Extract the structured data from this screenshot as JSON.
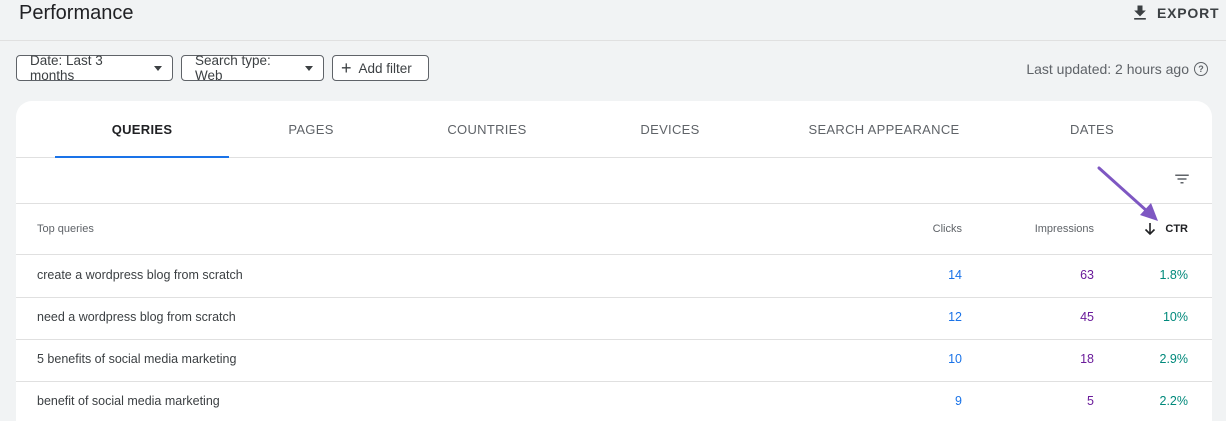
{
  "header": {
    "title": "Performance",
    "export_label": "EXPORT"
  },
  "filters": {
    "date": "Date: Last 3 months",
    "search_type": "Search type: Web",
    "add_filter": "Add filter",
    "last_updated": "Last updated: 2 hours ago"
  },
  "tabs": [
    "QUERIES",
    "PAGES",
    "COUNTRIES",
    "DEVICES",
    "SEARCH APPEARANCE",
    "DATES"
  ],
  "table": {
    "headers": {
      "query": "Top queries",
      "clicks": "Clicks",
      "impressions": "Impressions",
      "ctr": "CTR"
    },
    "rows": [
      {
        "query": "create a wordpress blog from scratch",
        "clicks": "14",
        "impressions": "63",
        "ctr": "1.8%"
      },
      {
        "query": "need a wordpress blog from scratch",
        "clicks": "12",
        "impressions": "45",
        "ctr": "10%"
      },
      {
        "query": "5 benefits of social media marketing",
        "clicks": "10",
        "impressions": "18",
        "ctr": "2.9%"
      },
      {
        "query": "benefit of social media marketing",
        "clicks": "9",
        "impressions": "5",
        "ctr": "2.2%"
      }
    ]
  },
  "colors": {
    "clicks": "#1a73e8",
    "impressions": "#6a1b9a",
    "ctr": "#00897b",
    "annotation_arrow": "#7e57c2"
  },
  "icons": {
    "export": "download-icon",
    "filter": "filter-list-icon",
    "sort": "arrow-down-icon",
    "help": "help-circle-icon"
  }
}
